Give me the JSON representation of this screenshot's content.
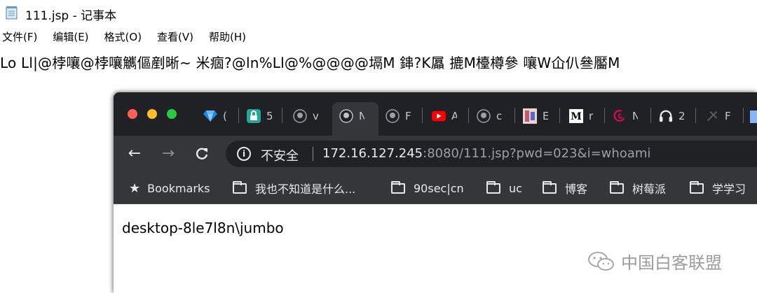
{
  "notepad": {
    "title": "111.jsp - 记事本",
    "menu": [
      "文件(F)",
      "编辑(E)",
      "格式(O)",
      "查看(V)",
      "帮助(H)"
    ],
    "content": "Lo    Ll|@桲嚷@桲嚷觽傴剷晰~ 米痼?@ln%Ll@%@@@@塥M 鋛?K屭    摝M檯樽參    嚷W仚仈叄靨M"
  },
  "browser": {
    "traffic_lights": {
      "close": "#ff5f57",
      "minimize": "#febc2e",
      "maximize": "#28c840"
    },
    "tabs": [
      {
        "icon": "gem-icon",
        "text": "("
      },
      {
        "icon": "lock-app-icon",
        "text": "5"
      },
      {
        "icon": "github-icon",
        "text": "v"
      },
      {
        "icon": "github-icon",
        "text": "N"
      },
      {
        "icon": "github-icon",
        "text": "F"
      },
      {
        "icon": "youtube-icon",
        "text": "A"
      },
      {
        "icon": "github-icon",
        "text": "c"
      },
      {
        "icon": "anime-icon",
        "text": "E"
      },
      {
        "icon": "medium-icon",
        "text": "r"
      },
      {
        "icon": "debian-icon",
        "text": "N"
      },
      {
        "icon": "headphones-icon",
        "text": "2"
      },
      {
        "icon": "faded-icon",
        "text": "F"
      }
    ],
    "security_label": "不安全",
    "url_host": "172.16.127.245",
    "url_rest": ":8080/111.jsp?pwd=023&i=whoami",
    "bookmarks": [
      {
        "icon": "star-icon",
        "label": "Bookmarks"
      },
      {
        "icon": "folder-icon",
        "label": "我也不知道是什么..."
      },
      {
        "icon": "folder-icon",
        "label": "90sec|cn"
      },
      {
        "icon": "folder-icon",
        "label": "uc"
      },
      {
        "icon": "folder-icon",
        "label": "博客"
      },
      {
        "icon": "folder-icon",
        "label": "树莓派"
      },
      {
        "icon": "folder-icon",
        "label": "学学习"
      }
    ],
    "page_text": "desktop-8le7l8n\\jumbo"
  },
  "watermark": {
    "text": "中国白客联盟"
  }
}
